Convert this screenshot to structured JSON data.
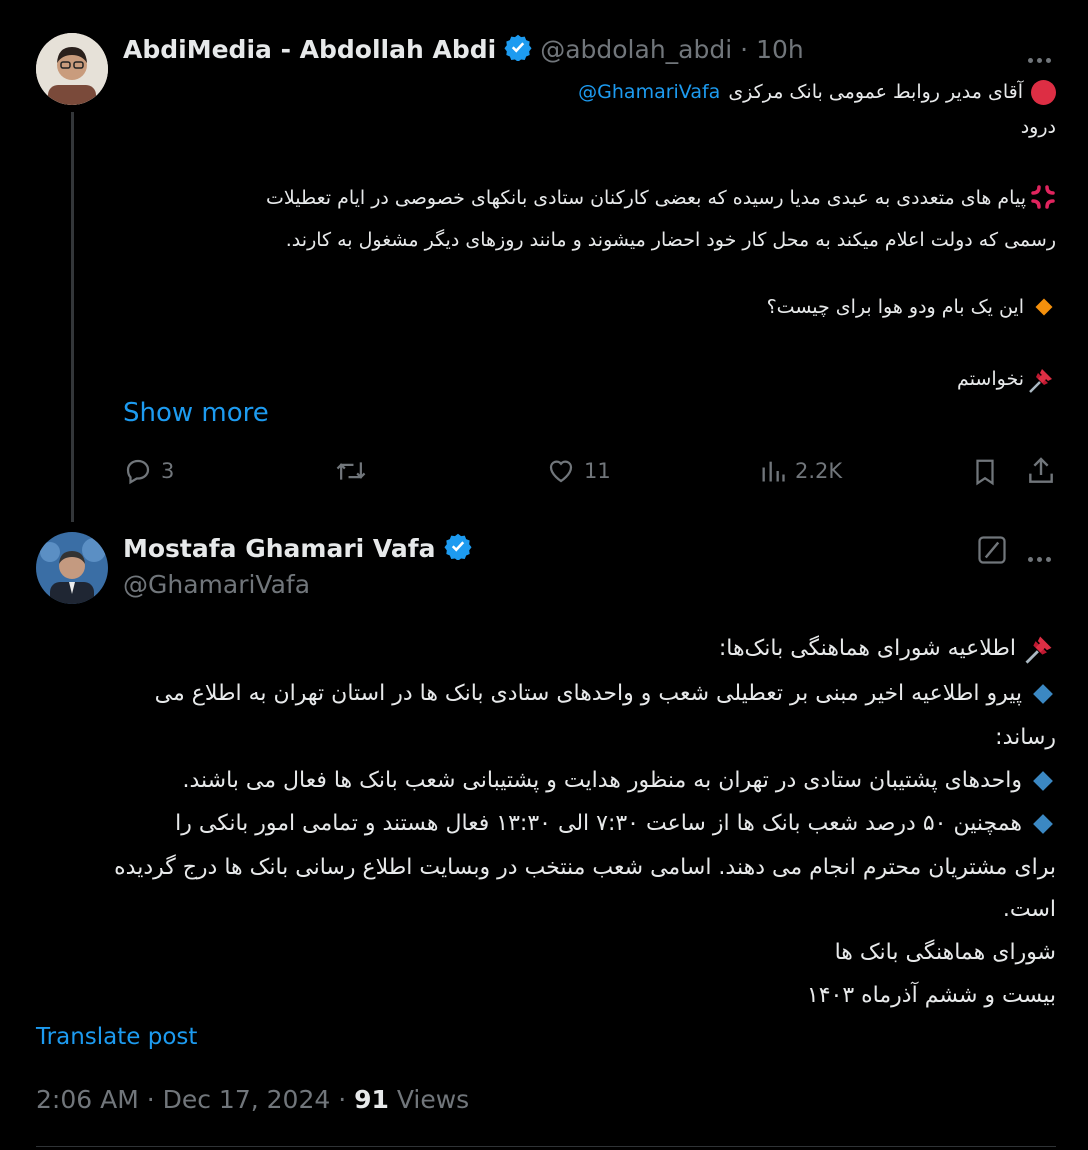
{
  "post1": {
    "author_name": "AbdiMedia - Abdollah Abdi",
    "handle": "@abdolah_abdi",
    "separator": "·",
    "time": "10h",
    "line1_text": "آقای مدیر روابط عمومی بانک مرکزی",
    "line1_mention": "@GhamariVafa",
    "line2": "درود",
    "para1_line1": "پیام های متعددی به عبدی مدیا رسیده که بعضی کارکنان ستادی بانکهای خصوصی در ایام تعطیلات",
    "para1_line2": "رسمی که دولت اعلام میکند به محل کار خود احضار میشوند و مانند روزهای دیگر مشغول به کارند.",
    "question": "این یک بام ودو هوا برای چیست؟",
    "closing": "نخواستم",
    "show_more": "Show more",
    "replies": "3",
    "likes": "11",
    "views": "2.2K"
  },
  "post2": {
    "author_name": "Mostafa Ghamari Vafa",
    "handle": "@GhamariVafa",
    "lines": [
      "اطلاعیه شورای هماهنگی بانک‌ها:",
      "پیرو اطلاعیه اخیر مبنی بر تعطیلی شعب و واحدهای ستادی بانک ها در استان تهران به اطلاع می",
      "رساند:",
      "واحدهای پشتیبان ستادی در تهران به منظور هدایت و پشتیبانی شعب بانک ها فعال می باشند.",
      "همچنین ۵۰ درصد شعب بانک ها از ساعت ۷:۳۰ الی ۱۳:۳۰ فعال هستند و تمامی امور بانکی را",
      "برای مشتریان محترم انجام می دهند. اسامی شعب منتخب  در وبسایت اطلاع رسانی بانک ها درج گردیده",
      "است.",
      "شورای هماهنگی بانک ها",
      "بیست و ششم آذرماه ۱۴۰۳"
    ],
    "translate": "Translate post",
    "timestamp": "2:06 AM · Dec 17, 2024 · ",
    "views_count": "91",
    "views_label": " Views"
  },
  "icons": {
    "red_circle": "red-circle-icon",
    "anger": "anger-icon",
    "orange_diamond": "orange-diamond-icon",
    "pushpin": "pushpin-icon",
    "blue_diamond": "blue-diamond-icon",
    "verified": "verified-badge-icon"
  },
  "colors": {
    "background": "#000000",
    "text": "#e7e9ea",
    "muted": "#71767b",
    "link": "#1d9bf0",
    "verified": "#1d9bf0"
  }
}
